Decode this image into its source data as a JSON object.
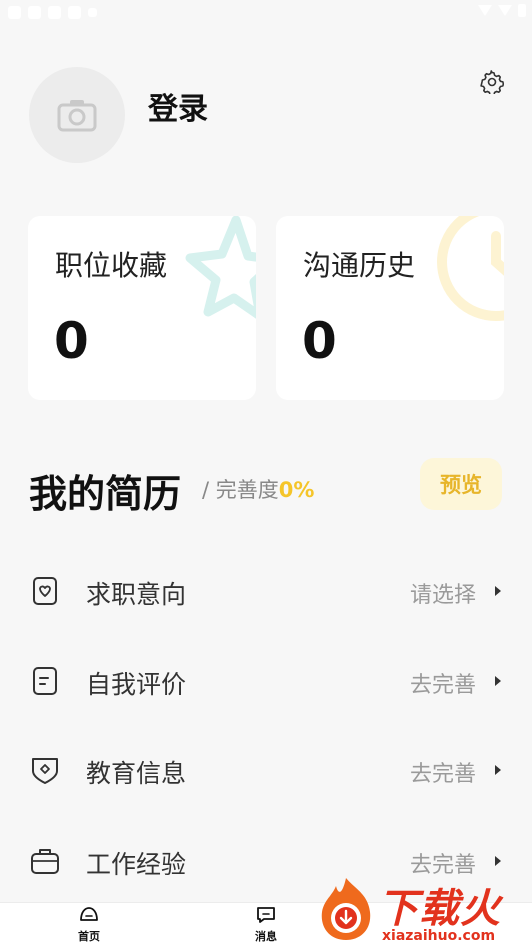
{
  "profile": {
    "login_label": "登录"
  },
  "cards": [
    {
      "title": "职位收藏",
      "count": "0"
    },
    {
      "title": "沟通历史",
      "count": "0"
    }
  ],
  "resume": {
    "title": "我的简历",
    "completeness_prefix": "/ 完善度",
    "completeness_value": "0%",
    "preview_label": "预览"
  },
  "resume_items": [
    {
      "label": "求职意向",
      "value": "请选择",
      "icon": "heart-card-icon"
    },
    {
      "label": "自我评价",
      "value": "去完善",
      "icon": "document-icon"
    },
    {
      "label": "教育信息",
      "value": "去完善",
      "icon": "shield-badge-icon"
    },
    {
      "label": "工作经验",
      "value": "去完善",
      "icon": "briefcase-icon"
    }
  ],
  "tabbar": {
    "items": [
      {
        "label": "首页",
        "icon": "home-icon"
      },
      {
        "label": "消息",
        "icon": "message-icon"
      }
    ]
  },
  "watermark": {
    "brand": "下载火",
    "domain": "xiazaihuo.com"
  },
  "colors": {
    "accent_yellow": "#f5c52a",
    "preview_bg": "#fdf6d9",
    "watermark_red": "#e2321d"
  }
}
